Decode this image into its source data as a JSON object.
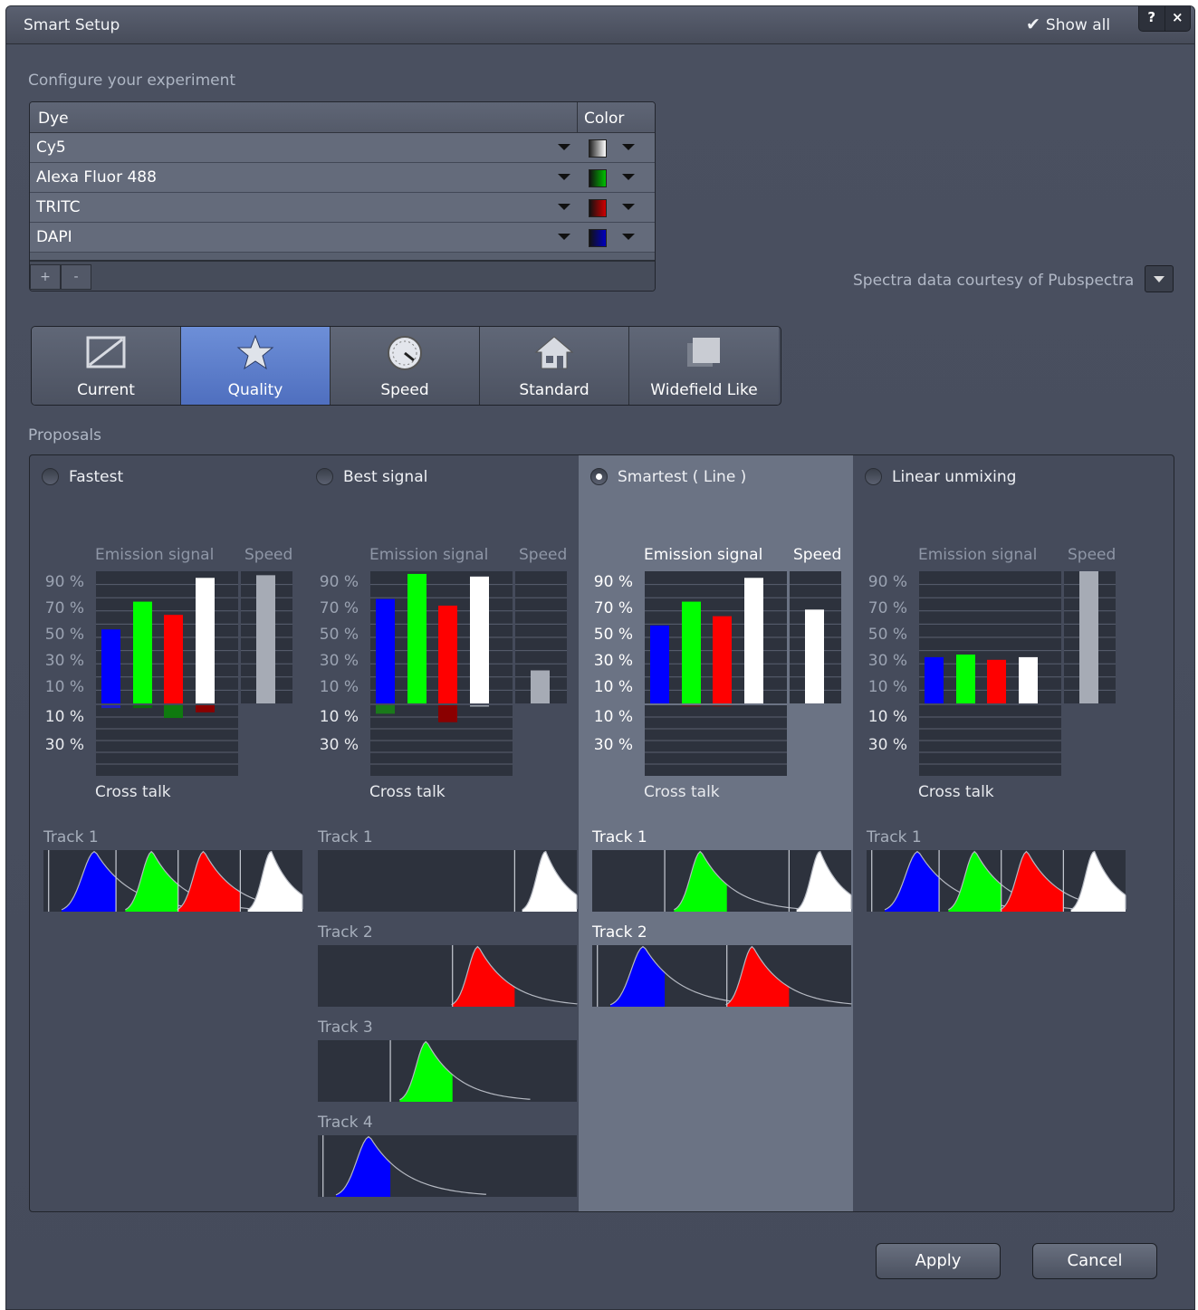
{
  "window": {
    "title": "Smart Setup",
    "show_all": "Show all",
    "help": "?",
    "close": "×"
  },
  "configure": {
    "heading": "Configure your experiment",
    "col_dye": "Dye",
    "col_color": "Color",
    "dyes": [
      {
        "name": "Cy5",
        "color": "#ffffff",
        "icon": "swatch-gradient-white"
      },
      {
        "name": "Alexa Fluor 488",
        "color": "#00c000"
      },
      {
        "name": "TRITC",
        "color": "#d00000"
      },
      {
        "name": "DAPI",
        "color": "#0000c0"
      }
    ],
    "add": "+",
    "remove": "-"
  },
  "courtesy": "Spectra data courtesy of Pubspectra",
  "presets": [
    {
      "label": "Current",
      "icon": "diagonal-frame-icon",
      "selected": false
    },
    {
      "label": "Quality",
      "icon": "star-icon",
      "selected": true
    },
    {
      "label": "Speed",
      "icon": "gauge-icon",
      "selected": false
    },
    {
      "label": "Standard",
      "icon": "house-icon",
      "selected": false
    },
    {
      "label": "Widefield Like",
      "icon": "stacked-squares-icon",
      "selected": false
    }
  ],
  "proposals": {
    "heading": "Proposals",
    "emission_label": "Emission signal",
    "speed_label": "Speed",
    "crosstalk_label": "Cross talk",
    "ticks_top": [
      "90 %",
      "70 %",
      "50 %",
      "30 %",
      "10 %"
    ],
    "ticks_bottom": [
      "10 %",
      "30 %"
    ],
    "bar_colors": [
      "#0000ff",
      "#00ff00",
      "#ff0000",
      "#ffffff"
    ],
    "options": [
      {
        "label": "Fastest",
        "selected": false,
        "emission": [
          56,
          77,
          67,
          95
        ],
        "crosstalk": [
          2,
          2,
          9,
          5
        ],
        "speed": 97,
        "tracks": [
          {
            "label": "Track 1",
            "dyes": [
              0,
              1,
              2,
              3
            ]
          }
        ]
      },
      {
        "label": "Best signal",
        "selected": false,
        "emission": [
          79,
          98,
          74,
          96
        ],
        "crosstalk": [
          6,
          0,
          12,
          1
        ],
        "speed": 25,
        "tracks": [
          {
            "label": "Track 1",
            "dyes": [
              3
            ]
          },
          {
            "label": "Track 2",
            "dyes": [
              2
            ]
          },
          {
            "label": "Track 3",
            "dyes": [
              1
            ]
          },
          {
            "label": "Track 4",
            "dyes": [
              0
            ]
          }
        ]
      },
      {
        "label": "Smartest ( Line )",
        "selected": true,
        "emission": [
          59,
          77,
          66,
          95
        ],
        "crosstalk": [
          0,
          1,
          1,
          0
        ],
        "speed": 71,
        "tracks": [
          {
            "label": "Track 1",
            "dyes": [
              1,
              3
            ]
          },
          {
            "label": "Track 2",
            "dyes": [
              0,
              2
            ]
          }
        ]
      },
      {
        "label": "Linear unmixing",
        "selected": false,
        "emission": [
          35,
          37,
          33,
          35
        ],
        "crosstalk": [
          0,
          0,
          0,
          0
        ],
        "speed": 100,
        "tracks": [
          {
            "label": "Track 1",
            "dyes": [
              0,
              1,
              2,
              3
            ]
          }
        ]
      }
    ]
  },
  "buttons": {
    "apply": "Apply",
    "cancel": "Cancel"
  }
}
